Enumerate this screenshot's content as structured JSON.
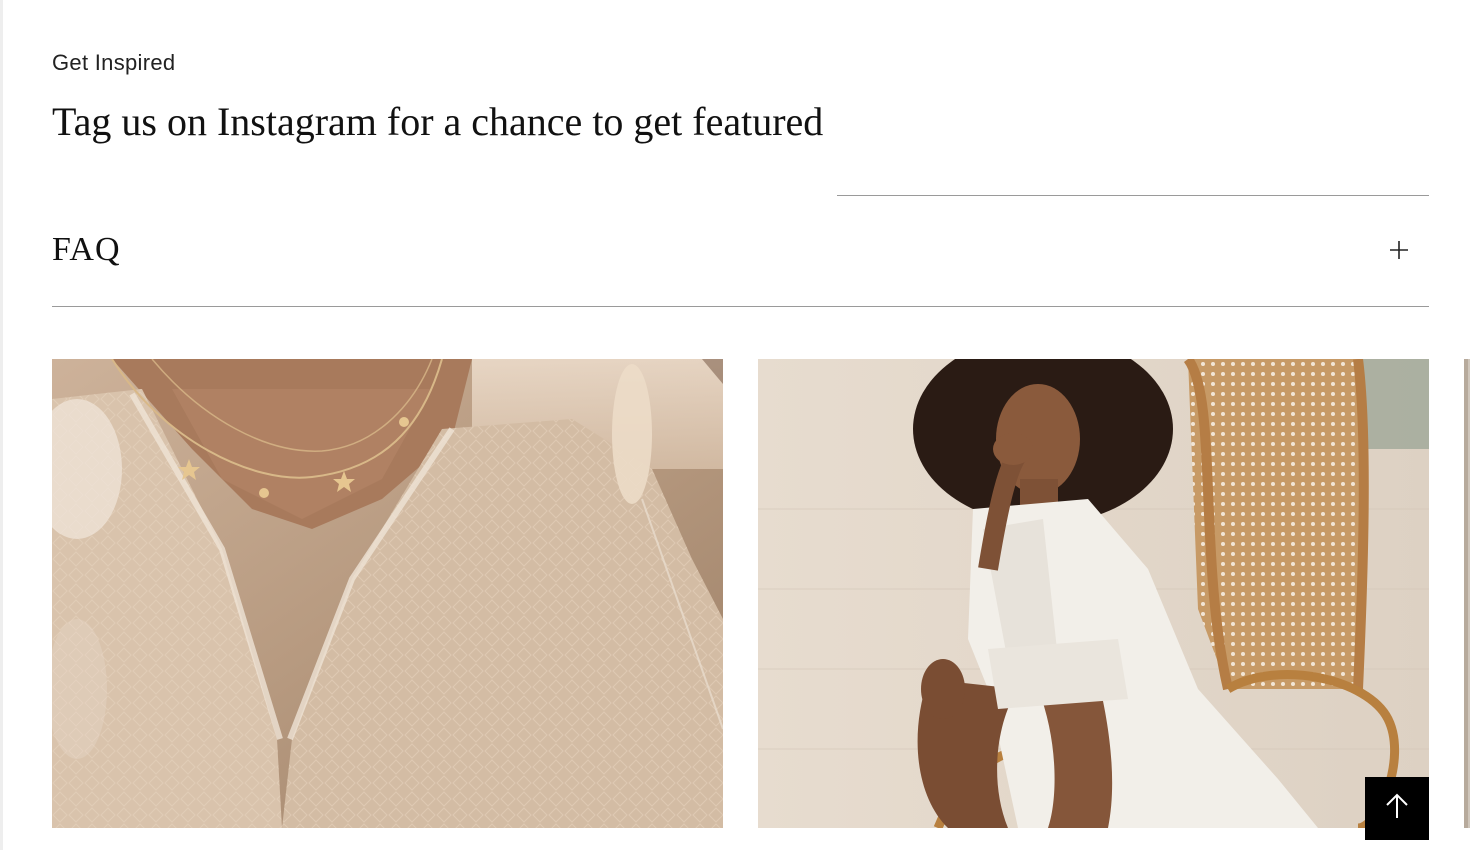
{
  "inspiration": {
    "eyebrow": "Get Inspired",
    "headline": "Tag us on Instagram for a chance to get featured"
  },
  "faq": {
    "title": "FAQ",
    "expanded": false,
    "toggle_icon": "plus-icon"
  },
  "instagram_feed": {
    "images": [
      {
        "name": "instagram-image-necklace",
        "tone": "#b49579"
      },
      {
        "name": "instagram-image-chair",
        "tone": "#d8c7b4"
      },
      {
        "name": "instagram-image-partial",
        "tone": "#cfc6bb"
      }
    ]
  },
  "back_to_top": {
    "icon": "arrow-up-icon",
    "background": "#000000"
  },
  "colors": {
    "text": "#111111",
    "rule": "#9a9a9a",
    "background": "#ffffff"
  }
}
